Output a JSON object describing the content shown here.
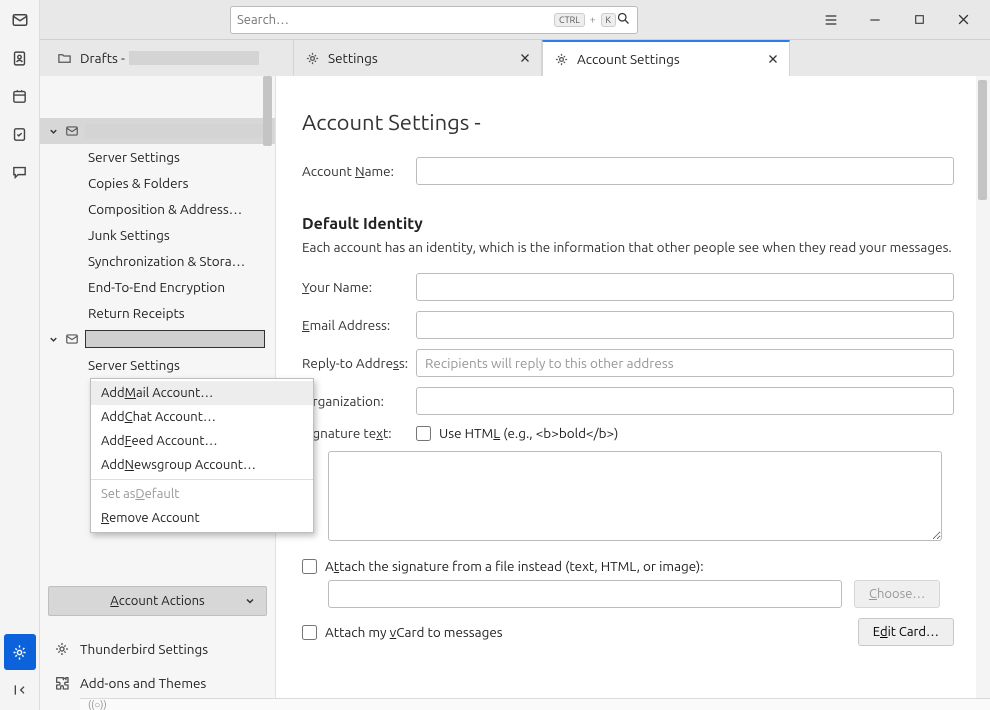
{
  "titlebar": {
    "search_placeholder": "Search…",
    "kbd": [
      "CTRL",
      "K"
    ]
  },
  "tabs": {
    "drafts_label": "Drafts -",
    "settings_label": "Settings",
    "account_settings_label": "Account Settings"
  },
  "tree": {
    "children": [
      "Server Settings",
      "Copies & Folders",
      "Composition & Address…",
      "Junk Settings",
      "Synchronization & Stora…",
      "End-To-End Encryption",
      "Return Receipts"
    ],
    "children2": [
      "Server Settings"
    ],
    "account_actions_label": "Account Actions",
    "tb_settings_label": "Thunderbird Settings",
    "addons_label": "Add-ons and Themes"
  },
  "popup": {
    "add_mail": "Add Mail Account…",
    "add_chat": "Add Chat Account…",
    "add_feed": "Add Feed Account…",
    "add_news": "Add Newsgroup Account…",
    "set_default": "Set as Default",
    "remove": "Remove Account"
  },
  "form": {
    "title": "Account Settings - ",
    "account_name_label": "Account Name:",
    "section_title": "Default Identity",
    "section_desc": "Each account has an identity, which is the information that other people see when they read your messages.",
    "your_name_label": "Your Name:",
    "email_label": "Email Address:",
    "reply_label": "Reply-to Address:",
    "reply_placeholder": "Recipients will reply to this other address",
    "org_label": "Organization:",
    "sig_label": "Signature text:",
    "use_html_label": "Use HTML (e.g., <b>bold</b>)",
    "attach_file_label": "Attach the signature from a file instead (text, HTML, or image):",
    "choose_label": "Choose…",
    "attach_vcard_label": "Attach my vCard to messages",
    "edit_card_label": "Edit Card…"
  },
  "statusbar": {
    "text": "((○))"
  }
}
